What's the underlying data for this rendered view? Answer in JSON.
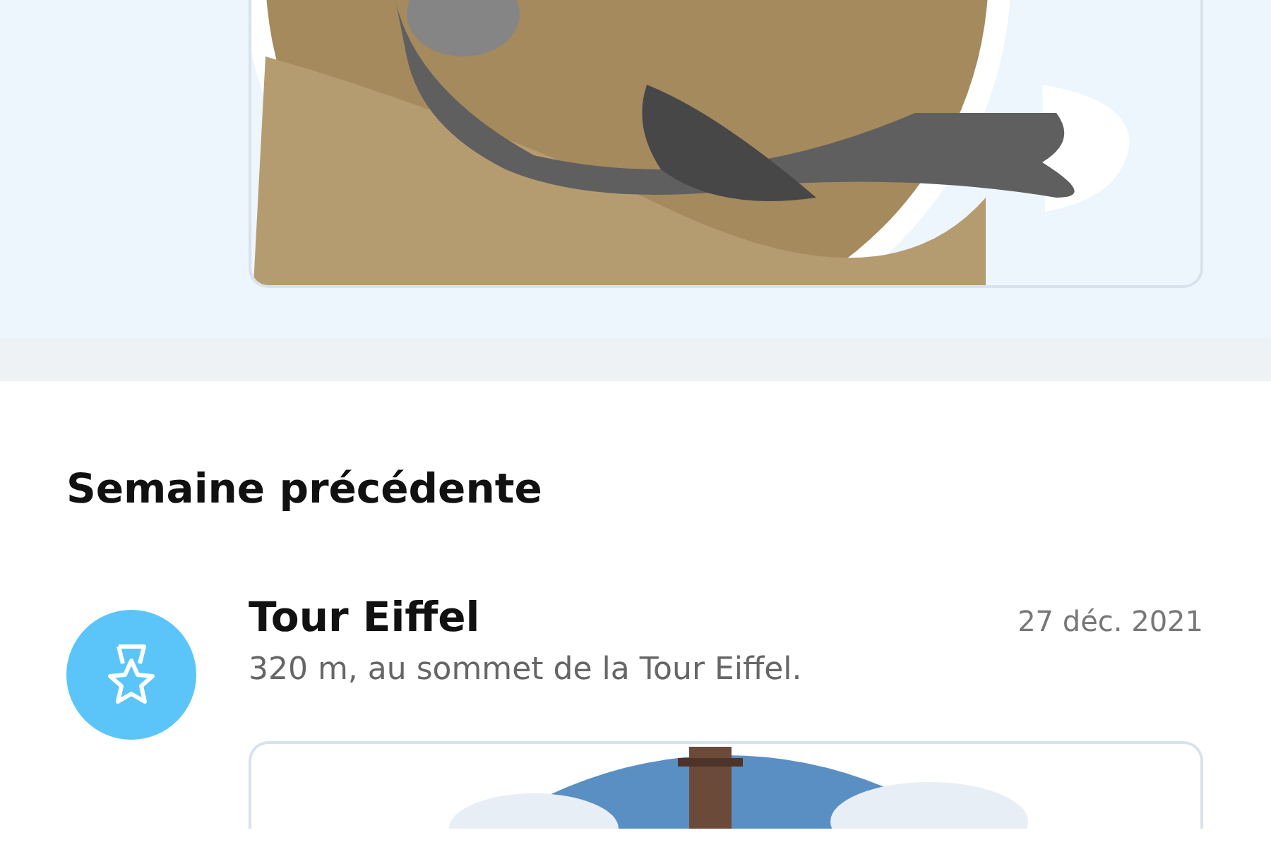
{
  "section": {
    "heading": "Semaine précédente"
  },
  "items": [
    {
      "title": "Tour Eiffel",
      "subtitle": "320 m, au sommet de la Tour Eiffel.",
      "date": "27 déc. 2021"
    }
  ]
}
